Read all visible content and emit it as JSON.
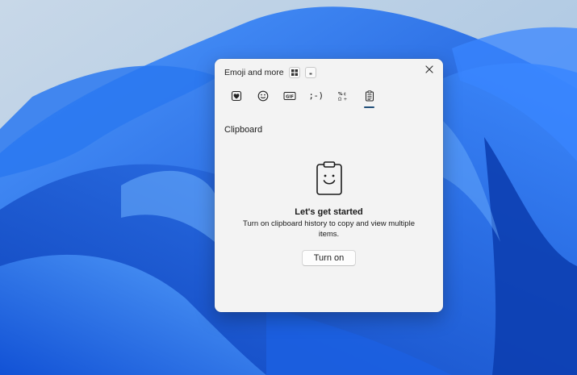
{
  "panel": {
    "title": "Emoji and more",
    "title_icons": [
      "grid-view-icon",
      "compact-view-icon"
    ],
    "close_icon": "close-icon"
  },
  "tabs": [
    {
      "icon": "favorites-heart-icon",
      "selected": false
    },
    {
      "icon": "emoji-smiley-icon",
      "selected": false
    },
    {
      "icon": "gif-icon",
      "label": "GIF",
      "selected": false
    },
    {
      "icon": "kaomoji-icon",
      "label": ";-)",
      "selected": false
    },
    {
      "icon": "symbols-icon",
      "selected": false
    },
    {
      "icon": "clipboard-icon",
      "selected": true
    }
  ],
  "section": {
    "title": "Clipboard"
  },
  "empty_state": {
    "icon": "clipboard-smiley-icon",
    "heading": "Let's get started",
    "description": "Turn on clipboard history to copy and view multiple items.",
    "button_label": "Turn on"
  },
  "colors": {
    "accent": "#1f4e79",
    "panel_bg": "#f3f3f3",
    "wallpaper_blue": "#1a6cf2"
  }
}
